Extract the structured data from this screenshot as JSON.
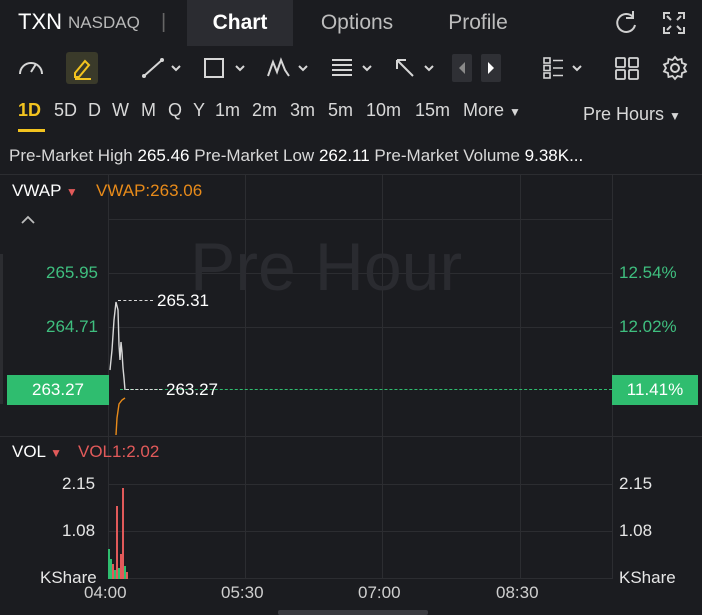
{
  "header": {
    "symbol": "TXN",
    "exchange": "NASDAQ",
    "separator": "|",
    "tabs": [
      {
        "label": "Chart",
        "active": true
      },
      {
        "label": "Options",
        "active": false
      },
      {
        "label": "Profile",
        "active": false
      }
    ],
    "icons": [
      "refresh-icon",
      "fullscreen-icon"
    ]
  },
  "toolbar": {
    "icons": [
      "gauge-icon",
      "draw-pencil-icon",
      "trendline-icon",
      "rectangle-icon",
      "pattern-icon",
      "text-note-icon",
      "arrow-icon",
      "prev-icon",
      "next-icon",
      "layout-grid-icon",
      "multi-chart-icon",
      "settings-icon"
    ]
  },
  "periods": {
    "items": [
      "1D",
      "5D",
      "D",
      "W",
      "M",
      "Q",
      "Y",
      "1m",
      "2m",
      "3m",
      "5m",
      "10m",
      "15m",
      "More"
    ],
    "active": "1D",
    "session": "Pre Hours"
  },
  "stats": {
    "high_label": "Pre-Market High",
    "high_value": "265.46",
    "low_label": "Pre-Market Low",
    "low_value": "262.11",
    "volume_label": "Pre-Market Volume",
    "volume_value": "9.38K..."
  },
  "price_panel": {
    "indicator": "VWAP",
    "indicator_value": "VWAP:263.06",
    "watermark": "Pre Hour",
    "left_axis": [
      "265.95",
      "264.71"
    ],
    "right_axis": [
      "12.54%",
      "12.02%"
    ],
    "current_price": "263.27",
    "current_pct": "11.41%",
    "high_annotation": "265.31",
    "last_annotation": "263.27"
  },
  "volume_panel": {
    "indicator": "VOL",
    "indicator_value": "VOL1:2.02",
    "left_axis": [
      "2.15",
      "1.08",
      "KShare"
    ],
    "right_axis": [
      "2.15",
      "1.08",
      "KShare"
    ]
  },
  "x_axis": [
    "04:00",
    "05:30",
    "07:00",
    "08:30"
  ],
  "colors": {
    "up": "#2fbd6f",
    "down": "#e25a5a",
    "vwap": "#e88b1a",
    "accent": "#f2c31f"
  }
}
